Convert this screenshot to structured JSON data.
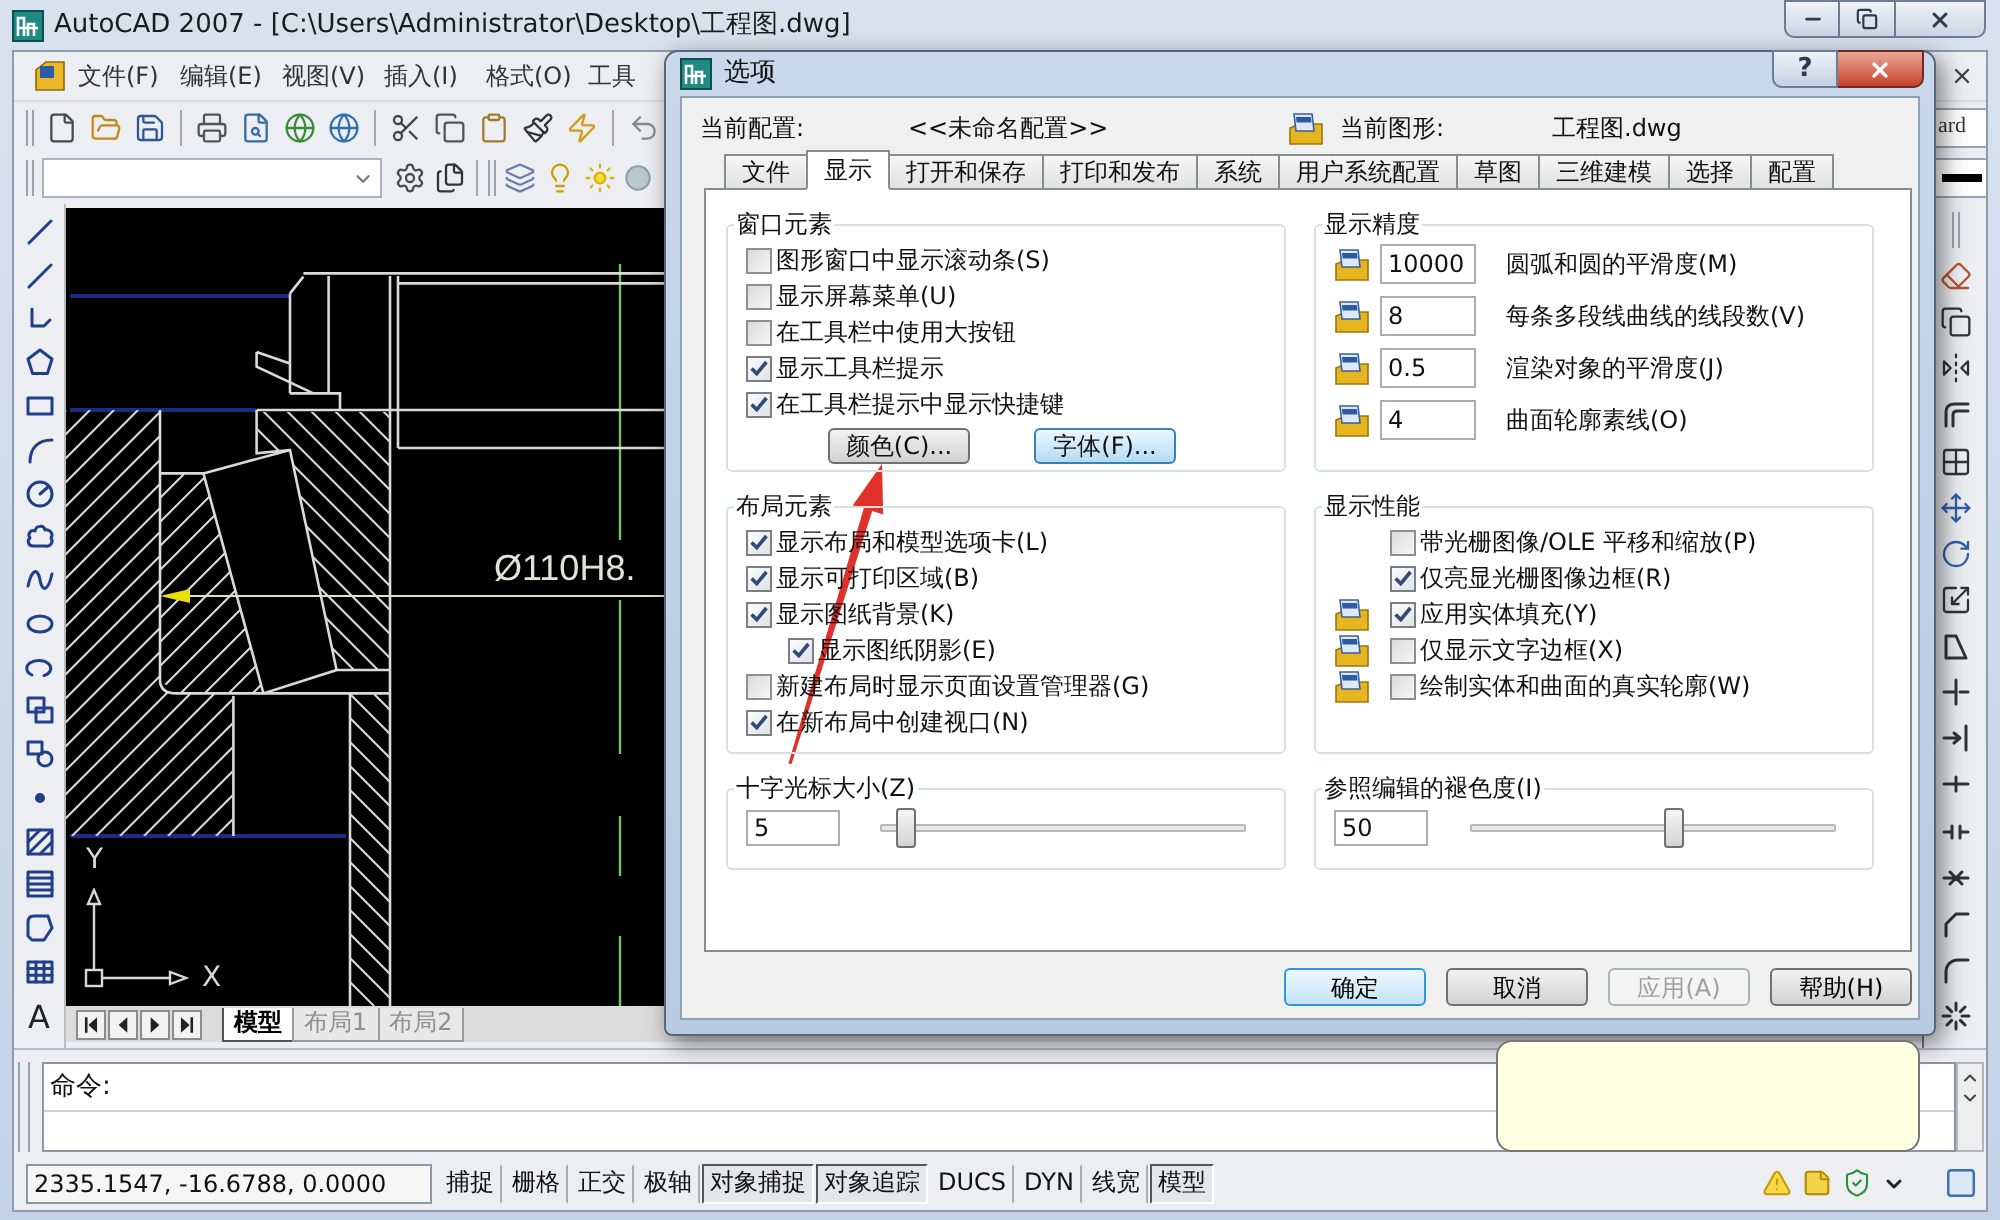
{
  "autocad": {
    "title": "AutoCAD 2007 - [C:\\Users\\Administrator\\Desktop\\工程图.dwg]",
    "menu": [
      "文件(F)",
      "编辑(E)",
      "视图(V)",
      "插入(I)",
      "格式(O)",
      "工具"
    ],
    "style_field_text": "ard",
    "text_tool_glyph": "A",
    "drawing": {
      "dimension_text": "Ø110H8.",
      "ucs_y_label": "Y",
      "ucs_x_label": "X"
    },
    "layout_tabs": [
      {
        "label": "模型",
        "selected": true
      },
      {
        "label": "布局1",
        "selected": false
      },
      {
        "label": "布局2",
        "selected": false
      }
    ],
    "command_prompt": "命令:",
    "coordinates": "2335.1547, -16.6788, 0.0000",
    "status_toggles": [
      {
        "label": "捕捉",
        "on": false
      },
      {
        "label": "栅格",
        "on": false
      },
      {
        "label": "正交",
        "on": false
      },
      {
        "label": "极轴",
        "on": false
      },
      {
        "label": "对象捕捉",
        "on": true
      },
      {
        "label": "对象追踪",
        "on": true
      },
      {
        "label": "DUCS",
        "on": false
      },
      {
        "label": "DYN",
        "on": false
      },
      {
        "label": "线宽",
        "on": false
      },
      {
        "label": "模型",
        "on": true
      }
    ]
  },
  "dialog": {
    "title": "选项",
    "help_glyph": "?",
    "current_profile_label": "当前配置:",
    "current_profile": "<<未命名配置>>",
    "current_drawing_label": "当前图形:",
    "current_drawing": "工程图.dwg",
    "tabs": [
      {
        "label": "文件",
        "selected": false
      },
      {
        "label": "显示",
        "selected": true
      },
      {
        "label": "打开和保存",
        "selected": false
      },
      {
        "label": "打印和发布",
        "selected": false
      },
      {
        "label": "系统",
        "selected": false
      },
      {
        "label": "用户系统配置",
        "selected": false
      },
      {
        "label": "草图",
        "selected": false
      },
      {
        "label": "三维建模",
        "selected": false
      },
      {
        "label": "选择",
        "selected": false
      },
      {
        "label": "配置",
        "selected": false
      }
    ],
    "window_elements": {
      "title": "窗口元素",
      "checkboxes": [
        {
          "label": "图形窗口中显示滚动条(S)",
          "checked": false
        },
        {
          "label": "显示屏幕菜单(U)",
          "checked": false
        },
        {
          "label": "在工具栏中使用大按钮",
          "checked": false
        },
        {
          "label": "显示工具栏提示",
          "checked": true
        },
        {
          "label": "在工具栏提示中显示快捷键",
          "checked": true
        }
      ],
      "buttons": [
        {
          "label": "颜色(C)...",
          "highlighted": false
        },
        {
          "label": "字体(F)...",
          "highlighted": true
        }
      ]
    },
    "layout_elements": {
      "title": "布局元素",
      "checkboxes": [
        {
          "label": "显示布局和模型选项卡(L)",
          "checked": true
        },
        {
          "label": "显示可打印区域(B)",
          "checked": true
        },
        {
          "label": "显示图纸背景(K)",
          "checked": true,
          "children": [
            {
              "label": "显示图纸阴影(E)",
              "checked": true
            }
          ]
        },
        {
          "label": "新建布局时显示页面设置管理器(G)",
          "checked": false
        },
        {
          "label": "在新布局中创建视口(N)",
          "checked": true
        }
      ]
    },
    "crosshair_size": {
      "title": "十字光标大小(Z)",
      "value": "5",
      "level": 0.04
    },
    "display_resolution": {
      "title": "显示精度",
      "rows": [
        {
          "value": "10000",
          "label": "圆弧和圆的平滑度(M)"
        },
        {
          "value": "8",
          "label": "每条多段线曲线的线段数(V)"
        },
        {
          "value": "0.5",
          "label": "渲染对象的平滑度(J)"
        },
        {
          "value": "4",
          "label": "曲面轮廓素线(O)"
        }
      ]
    },
    "display_performance": {
      "title": "显示性能",
      "checkboxes": [
        {
          "label": "带光栅图像/OLE 平移和缩放(P)",
          "checked": false,
          "saved_in_drawing": false
        },
        {
          "label": "仅亮显光栅图像边框(R)",
          "checked": true,
          "saved_in_drawing": false
        },
        {
          "label": "应用实体填充(Y)",
          "checked": true,
          "saved_in_drawing": true
        },
        {
          "label": "仅显示文字边框(X)",
          "checked": false,
          "saved_in_drawing": true
        },
        {
          "label": "绘制实体和曲面的真实轮廓(W)",
          "checked": false,
          "saved_in_drawing": true
        }
      ]
    },
    "xref_fade": {
      "title": "参照编辑的褪色度(I)",
      "value": "50",
      "level": 0.56
    },
    "buttons": [
      {
        "label": "确定",
        "default": true,
        "disabled": false
      },
      {
        "label": "取消",
        "default": false,
        "disabled": false
      },
      {
        "label": "应用(A)",
        "default": false,
        "disabled": true
      },
      {
        "label": "帮助(H)",
        "default": false,
        "disabled": false
      }
    ]
  }
}
